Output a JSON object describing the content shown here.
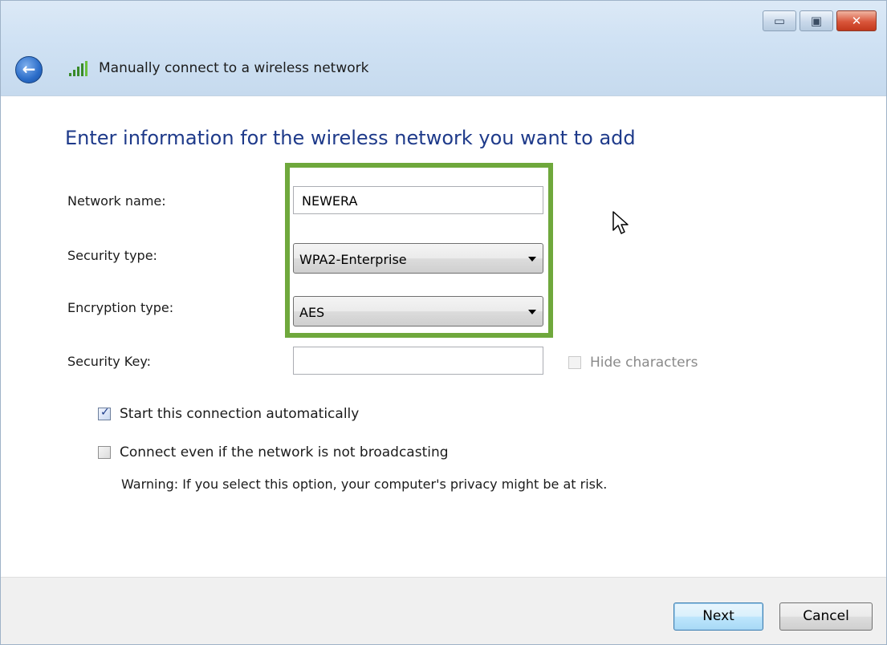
{
  "window": {
    "title": "Manually connect to a wireless network",
    "minimize_glyph": "▭",
    "maximize_glyph": "▣",
    "close_glyph": "✕",
    "back_glyph": "←"
  },
  "page": {
    "heading": "Enter information for the wireless network you want to add"
  },
  "form": {
    "network_name": {
      "label": "Network name:",
      "value": "NEWERA"
    },
    "security_type": {
      "label": "Security type:",
      "value": "WPA2-Enterprise"
    },
    "encryption_type": {
      "label": "Encryption type:",
      "value": "AES"
    },
    "security_key": {
      "label": "Security Key:",
      "value": ""
    },
    "hide_characters": {
      "label": "Hide characters",
      "checked": false,
      "enabled": false
    }
  },
  "options": {
    "start_automatically": {
      "label": "Start this connection automatically",
      "checked": true
    },
    "connect_not_broadcasting": {
      "label": "Connect even if the network is not broadcasting",
      "checked": false
    },
    "warning": "Warning: If you select this option, your computer's privacy might be at risk."
  },
  "footer": {
    "next_label": "Next",
    "cancel_label": "Cancel"
  },
  "colors": {
    "highlight": "#6fa83c",
    "heading": "#1e3a8a"
  }
}
